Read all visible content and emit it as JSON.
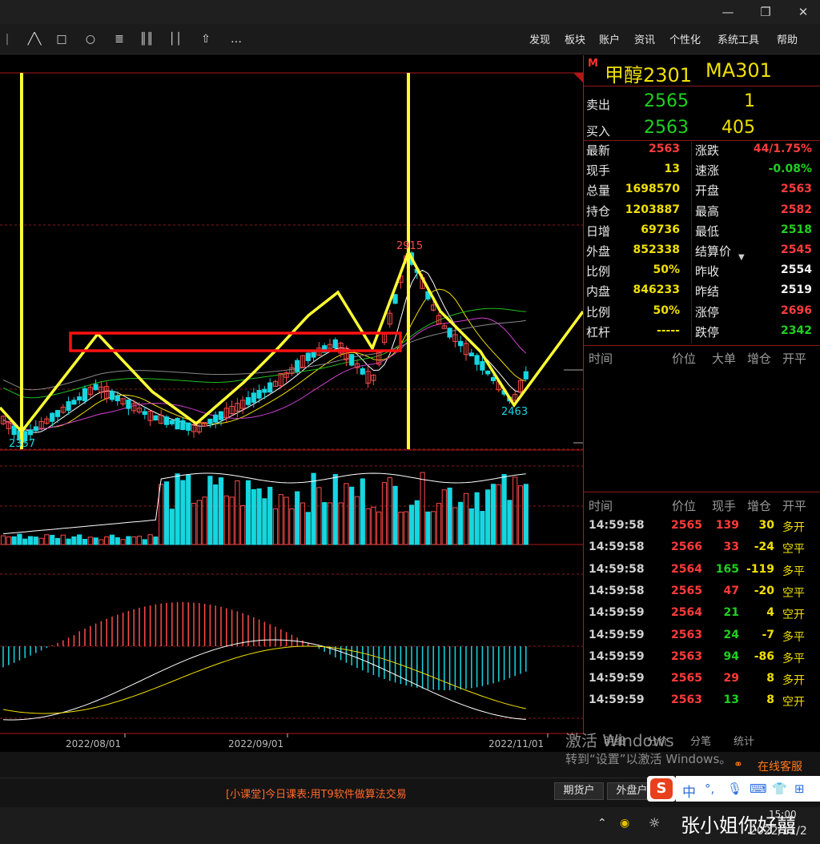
{
  "window": {
    "minimize": "—",
    "maximize": "❐",
    "close": "✕"
  },
  "toolbar": {
    "tools": [
      "trend-line-icon",
      "rectangle-icon",
      "circle-icon",
      "text-icon",
      "fib-lines-icon",
      "parallel-lines-icon",
      "arrow-up-icon",
      "more-icon"
    ],
    "tool_glyphs": [
      "╱╲",
      "□",
      "○",
      "≣",
      "║║",
      "││",
      "⇧",
      "…"
    ],
    "menu": [
      "发现",
      "板块",
      "账户",
      "资讯",
      "个性化",
      "系统工具",
      "帮助"
    ]
  },
  "chart": {
    "labels": {
      "high": "2915",
      "low_left": "2357",
      "low_right": "2463"
    },
    "dates": [
      "2022/08/01",
      "2022/09/01",
      "2022/11/01"
    ],
    "colors": {
      "up": "#ff4a4a",
      "down": "#16d6e0",
      "drawing": "#ffff33",
      "box": "#ff1111",
      "grid": "#8a1a1a"
    }
  },
  "chart_data": {
    "type": "candlestick",
    "instrument": "甲醇2301",
    "price_extremes": {
      "low_left": 2357,
      "high": 2915,
      "low_right": 2463
    },
    "x_ticks": [
      "2022/08/01",
      "2022/09/01",
      "2022/11/01"
    ]
  },
  "quote": {
    "badge": "M",
    "name": "甲醇2301",
    "code": "MA301",
    "sell_label": "卖出",
    "sell_price": "2565",
    "sell_qty": "1",
    "buy_label": "买入",
    "buy_price": "2563",
    "buy_qty": "405",
    "rows": [
      {
        "l1": "最新",
        "v1": "2563",
        "c1": "red",
        "l2": "涨跌",
        "v2": "44/1.75%",
        "c2": "red"
      },
      {
        "l1": "现手",
        "v1": "13",
        "c1": "yellow",
        "l2": "速涨",
        "v2": "-0.08%",
        "c2": "green"
      },
      {
        "l1": "总量",
        "v1": "1698570",
        "c1": "yellow",
        "l2": "开盘",
        "v2": "2563",
        "c2": "red"
      },
      {
        "l1": "持仓",
        "v1": "1203887",
        "c1": "yellow",
        "l2": "最高",
        "v2": "2582",
        "c2": "red"
      },
      {
        "l1": "日增",
        "v1": "69736",
        "c1": "yellow",
        "l2": "最低",
        "v2": "2518",
        "c2": "green"
      },
      {
        "l1": "外盘",
        "v1": "852338",
        "c1": "yellow",
        "l2": "结算价",
        "v2": "2545",
        "c2": "red"
      },
      {
        "l1": "比例",
        "v1": "50%",
        "c1": "yellow",
        "l2": "昨收",
        "v2": "2554",
        "c2": "white"
      },
      {
        "l1": "内盘",
        "v1": "846233",
        "c1": "yellow",
        "l2": "昨结",
        "v2": "2519",
        "c2": "white"
      },
      {
        "l1": "比例",
        "v1": "50%",
        "c1": "yellow",
        "l2": "涨停",
        "v2": "2696",
        "c2": "red"
      },
      {
        "l1": "杠杆",
        "v1": "-----",
        "c1": "yellow",
        "l2": "跌停",
        "v2": "2342",
        "c2": "green"
      }
    ]
  },
  "bigorder": {
    "headers": [
      "时间",
      "价位",
      "大单",
      "增仓",
      "开平"
    ]
  },
  "ticks": {
    "headers": [
      "时间",
      "价位",
      "现手",
      "增仓",
      "开平"
    ],
    "rows": [
      {
        "t": "14:59:58",
        "p": "2565",
        "pc": "red",
        "q": "139",
        "qc": "red",
        "d": "30",
        "o": "多开"
      },
      {
        "t": "14:59:58",
        "p": "2566",
        "pc": "red",
        "q": "33",
        "qc": "red",
        "d": "-24",
        "o": "空平"
      },
      {
        "t": "14:59:58",
        "p": "2564",
        "pc": "red",
        "q": "165",
        "qc": "green",
        "d": "-119",
        "o": "多平"
      },
      {
        "t": "14:59:58",
        "p": "2565",
        "pc": "red",
        "q": "47",
        "qc": "red",
        "d": "-20",
        "o": "空平"
      },
      {
        "t": "14:59:59",
        "p": "2564",
        "pc": "red",
        "q": "21",
        "qc": "green",
        "d": "4",
        "o": "空开"
      },
      {
        "t": "14:59:59",
        "p": "2563",
        "pc": "red",
        "q": "24",
        "qc": "green",
        "d": "-7",
        "o": "多平"
      },
      {
        "t": "14:59:59",
        "p": "2563",
        "pc": "red",
        "q": "94",
        "qc": "green",
        "d": "-86",
        "o": "多平"
      },
      {
        "t": "14:59:59",
        "p": "2565",
        "pc": "red",
        "q": "29",
        "qc": "red",
        "d": "8",
        "o": "多开"
      },
      {
        "t": "14:59:59",
        "p": "2563",
        "pc": "red",
        "q": "13",
        "qc": "green",
        "d": "8",
        "o": "空开"
      }
    ]
  },
  "tabs": [
    "明细",
    "分价",
    "分笔",
    "统计"
  ],
  "watermark": {
    "line1": "激活 Windows",
    "line2": "转到“设置”以激活 Windows。"
  },
  "service": "在线客服",
  "ticker": "[小课堂]今日课表:用T9软件做算法交易",
  "bottom_buttons": [
    "期货户",
    "外盘户"
  ],
  "ime": {
    "logo": "S",
    "lang": "中",
    "icons": [
      "°,",
      "🎙",
      "⌨",
      "👕",
      "⊞"
    ]
  },
  "tray": {
    "time": "15:00",
    "date": "2022/11/2"
  },
  "weibo": "张小姐你好囍"
}
